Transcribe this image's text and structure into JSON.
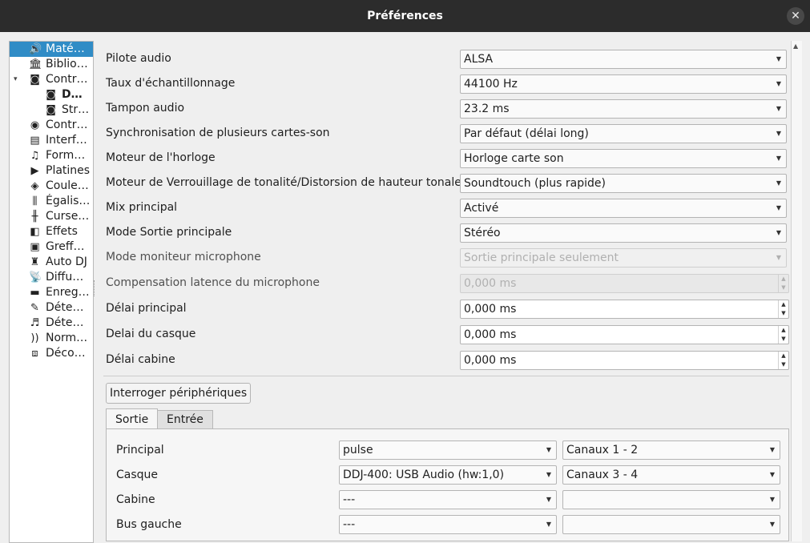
{
  "window": {
    "title": "Préférences",
    "close_glyph": "✕"
  },
  "sidebar": {
    "items": [
      {
        "label": "Maté…",
        "icon": "speaker-icon",
        "glyph": "🔊"
      },
      {
        "label": "Biblio…",
        "icon": "library-icon",
        "glyph": "🏛"
      },
      {
        "label": "Contr…",
        "icon": "controller-icon",
        "glyph": "◙",
        "expand": "▾"
      },
      {
        "label": "D…",
        "icon": "controller-device-icon",
        "glyph": "◙"
      },
      {
        "label": "Str…",
        "icon": "controller-device-icon",
        "glyph": "◙"
      },
      {
        "label": "Contr…",
        "icon": "vinyl-icon",
        "glyph": "◉"
      },
      {
        "label": "Interf…",
        "icon": "interface-icon",
        "glyph": "▤"
      },
      {
        "label": "Form…",
        "icon": "waveform-icon",
        "glyph": "♫"
      },
      {
        "label": "Platines",
        "icon": "play-icon",
        "glyph": "▶"
      },
      {
        "label": "Coule…",
        "icon": "color-icon",
        "glyph": "◈"
      },
      {
        "label": "Égalis…",
        "icon": "equalizer-icon",
        "glyph": "⫼"
      },
      {
        "label": "Curse…",
        "icon": "crossfader-icon",
        "glyph": "╫"
      },
      {
        "label": "Effets",
        "icon": "effects-icon",
        "glyph": "◧"
      },
      {
        "label": "Greff…",
        "icon": "plugin-icon",
        "glyph": "▣"
      },
      {
        "label": "Auto DJ",
        "icon": "robot-icon",
        "glyph": "♜"
      },
      {
        "label": "Diffu…",
        "icon": "broadcast-icon",
        "glyph": "📡"
      },
      {
        "label": "Enreg…",
        "icon": "record-icon",
        "glyph": "▬"
      },
      {
        "label": "Déte…",
        "icon": "bpm-detect-icon",
        "glyph": "✎"
      },
      {
        "label": "Déte…",
        "icon": "key-detect-icon",
        "glyph": "♬"
      },
      {
        "label": "Norm…",
        "icon": "normalize-icon",
        "glyph": "))"
      },
      {
        "label": "Déco…",
        "icon": "vinyl-control-icon",
        "glyph": "⧈"
      }
    ]
  },
  "settings": {
    "rows": [
      {
        "label": "Pilote audio",
        "value": "ALSA",
        "type": "combo"
      },
      {
        "label": "Taux d'échantillonnage",
        "value": "44100 Hz",
        "type": "combo"
      },
      {
        "label": "Tampon audio",
        "value": "23.2 ms",
        "type": "combo"
      },
      {
        "label": "Synchronisation de plusieurs cartes-son",
        "value": "Par défaut (délai long)",
        "type": "combo"
      },
      {
        "label": "Moteur de l'horloge",
        "value": "Horloge carte son",
        "type": "combo"
      },
      {
        "label": "Moteur de Verrouillage de tonalité/Distorsion de hauteur tonale",
        "value": "Soundtouch (plus rapide)",
        "type": "combo"
      },
      {
        "label": "Mix principal",
        "value": "Activé",
        "type": "combo"
      },
      {
        "label": "Mode Sortie principale",
        "value": "Stéréo",
        "type": "combo"
      },
      {
        "label": "Mode moniteur microphone",
        "value": "Sortie principale seulement",
        "type": "combo-disabled"
      },
      {
        "label": "Compensation latence du microphone",
        "value": "0,000 ms",
        "type": "spin-disabled"
      },
      {
        "label": "Délai principal",
        "value": "0,000 ms",
        "type": "spin"
      },
      {
        "label": "Delai du casque",
        "value": "0,000 ms",
        "type": "spin"
      },
      {
        "label": "Délai cabine",
        "value": "0,000 ms",
        "type": "spin"
      }
    ],
    "query_button": "Interroger périphériques"
  },
  "tabs": {
    "output": "Sortie",
    "input": "Entrée"
  },
  "devices": [
    {
      "label": "Principal",
      "device": "pulse",
      "channels": "Canaux 1 - 2"
    },
    {
      "label": "Casque",
      "device": "DDJ-400: USB Audio (hw:1,0)",
      "channels": "Canaux 3 - 4"
    },
    {
      "label": "Cabine",
      "device": "---",
      "channels": ""
    },
    {
      "label": "Bus gauche",
      "device": "---",
      "channels": ""
    }
  ],
  "glyphs": {
    "dropdown": "▼",
    "spin_up": "▲",
    "spin_down": "▼",
    "scroll_up": "▲"
  },
  "colors": {
    "selection": "#308cc6",
    "titlebar": "#2c2c2c"
  }
}
